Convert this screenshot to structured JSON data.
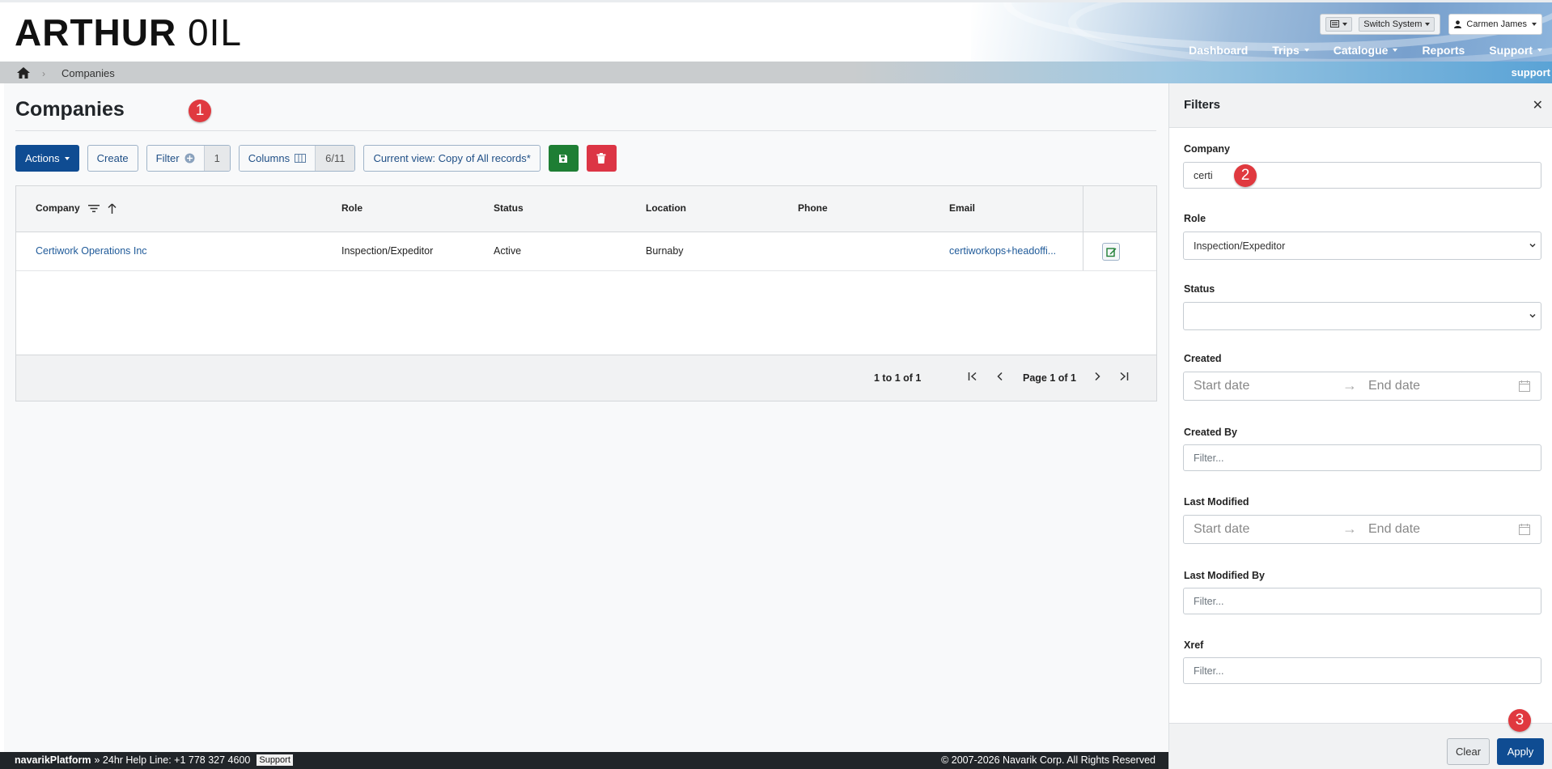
{
  "brand": {
    "logo_bold": "ARTHUR",
    "logo_light": "0IL"
  },
  "topbar": {
    "switch_system": "Switch System",
    "user": "Carmen James"
  },
  "nav": [
    {
      "label": "Dashboard"
    },
    {
      "label": "Trips"
    },
    {
      "label": "Catalogue"
    },
    {
      "label": "Reports"
    },
    {
      "label": "Support"
    }
  ],
  "breadcrumb": {
    "current": "Companies",
    "right_label": "support"
  },
  "page": {
    "title": "Companies"
  },
  "toolbar": {
    "actions": "Actions",
    "create": "Create",
    "filter": "Filter",
    "filter_count": "1",
    "columns": "Columns",
    "columns_count": "6/11",
    "current_view": "Current view: Copy of All records*"
  },
  "markers": {
    "m1": "1",
    "m2": "2",
    "m3": "3"
  },
  "table": {
    "headers": [
      "Company",
      "Role",
      "Status",
      "Location",
      "Phone",
      "Email"
    ],
    "rows": [
      {
        "company": "Certiwork Operations Inc",
        "role": "Inspection/Expeditor",
        "status": "Active",
        "location": "Burnaby",
        "phone": "",
        "email": "certiworkops+headoffi..."
      }
    ]
  },
  "pagination": {
    "summary": "1 to 1 of 1",
    "page": "Page 1 of 1"
  },
  "footer": {
    "platform": "navarikPlatform",
    "helpline": "» 24hr Help Line: +1 778 327 4600",
    "support": "Support",
    "copyright": "© 2007-2026 Navarik Corp. All Rights Reserved"
  },
  "filters": {
    "title": "Filters",
    "company_label": "Company",
    "company_value": "certi",
    "role_label": "Role",
    "role_value": "Inspection/Expeditor",
    "status_label": "Status",
    "status_value": "",
    "created_label": "Created",
    "start_placeholder": "Start date",
    "end_placeholder": "End date",
    "created_by_label": "Created By",
    "filter_placeholder": "Filter...",
    "last_modified_label": "Last Modified",
    "last_modified_by_label": "Last Modified By",
    "xref_label": "Xref",
    "clear": "Clear",
    "apply": "Apply"
  },
  "colors": {
    "primary": "#0f4c92",
    "save": "#1e7e34",
    "delete": "#dc3545",
    "marker": "#e0393f",
    "link": "#1f5a99"
  }
}
